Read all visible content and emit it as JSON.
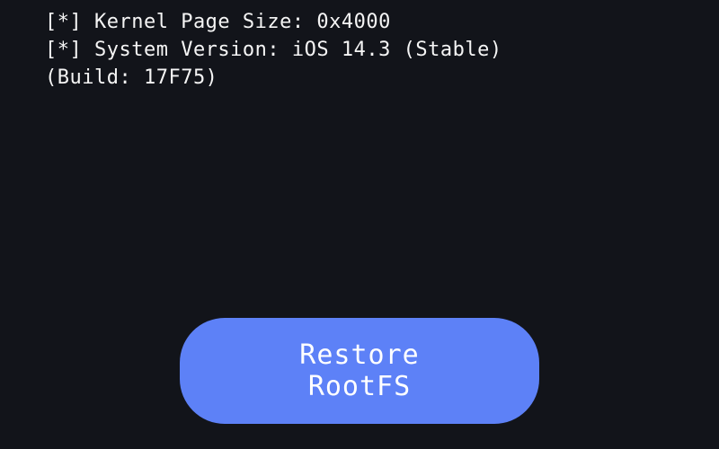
{
  "log": {
    "lines": [
      "[*] Kernel Page Size: 0x4000",
      "[*] System Version: iOS 14.3 (Stable)",
      "(Build: 17F75)"
    ]
  },
  "button": {
    "restore_label": "Restore RootFS"
  },
  "colors": {
    "background": "#12141a",
    "text": "#f5f5f5",
    "button_bg": "#5d81f7",
    "button_text": "#ffffff"
  }
}
